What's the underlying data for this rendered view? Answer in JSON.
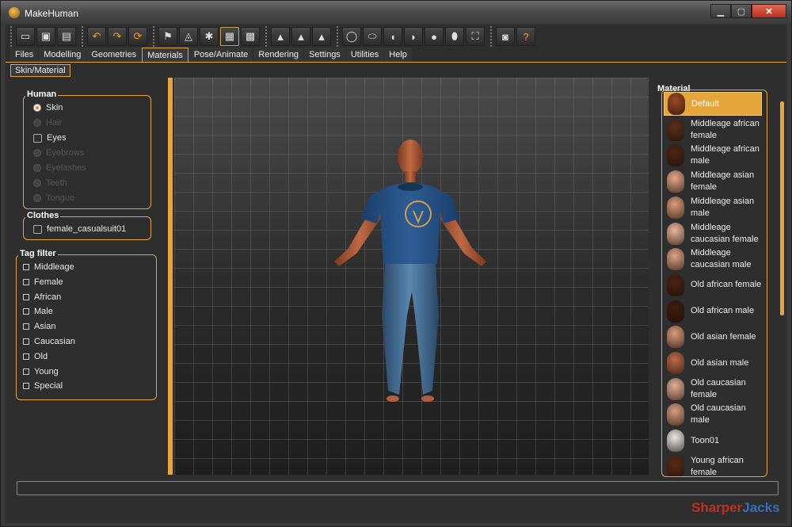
{
  "window": {
    "title": "MakeHuman",
    "min_symbol": "▁",
    "max_symbol": "▢",
    "close_symbol": "✕"
  },
  "toolbar": {
    "groups": [
      [
        {
          "icon": "load-icon",
          "glyph": "▭"
        },
        {
          "icon": "save-icon",
          "glyph": "▣"
        },
        {
          "icon": "export-icon",
          "glyph": "▤"
        }
      ],
      [
        {
          "icon": "undo-icon",
          "glyph": "↶"
        },
        {
          "icon": "redo-icon",
          "glyph": "↷"
        },
        {
          "icon": "reset-icon",
          "glyph": "⟳"
        }
      ],
      [
        {
          "icon": "smooth-icon",
          "glyph": "⚑"
        },
        {
          "icon": "wireframe-icon",
          "glyph": "◬"
        },
        {
          "icon": "pose-icon",
          "glyph": "✱"
        },
        {
          "icon": "grid-icon",
          "glyph": "▦"
        },
        {
          "icon": "checker-icon",
          "glyph": "▩"
        }
      ],
      [
        {
          "icon": "front-view-icon",
          "glyph": "▲"
        },
        {
          "icon": "back-view-icon",
          "glyph": "▲"
        },
        {
          "icon": "side-view-icon",
          "glyph": "▲"
        }
      ],
      [
        {
          "icon": "head-front-icon",
          "glyph": "◯"
        },
        {
          "icon": "head-back-icon",
          "glyph": "⬭"
        },
        {
          "icon": "head-left-icon",
          "glyph": "◖"
        },
        {
          "icon": "head-right-icon",
          "glyph": "◗"
        },
        {
          "icon": "head-top-icon",
          "glyph": "●"
        },
        {
          "icon": "head-bottom-icon",
          "glyph": "⬮"
        },
        {
          "icon": "reset-camera-icon",
          "glyph": "⛶"
        }
      ],
      [
        {
          "icon": "screenshot-icon",
          "glyph": "◙"
        },
        {
          "icon": "help-icon",
          "glyph": "?"
        }
      ]
    ]
  },
  "tabs": [
    "Files",
    "Modelling",
    "Geometries",
    "Materials",
    "Pose/Animate",
    "Rendering",
    "Settings",
    "Utilities",
    "Help"
  ],
  "active_tab": "Materials",
  "subtab": "Skin/Material",
  "human": {
    "title": "Human",
    "items": [
      {
        "label": "Skin",
        "selected": true,
        "enabled": true
      },
      {
        "label": "Hair",
        "selected": false,
        "enabled": false
      },
      {
        "label": "Eyes",
        "selected": false,
        "enabled": true
      },
      {
        "label": "Eyebrows",
        "selected": false,
        "enabled": false
      },
      {
        "label": "Eyelashes",
        "selected": false,
        "enabled": false
      },
      {
        "label": "Teeth",
        "selected": false,
        "enabled": false
      },
      {
        "label": "Tongue",
        "selected": false,
        "enabled": false
      }
    ]
  },
  "clothes": {
    "title": "Clothes",
    "items": [
      "female_casualsuit01"
    ]
  },
  "tag_filter": {
    "title": "Tag filter",
    "items": [
      "Middleage",
      "Female",
      "African",
      "Male",
      "Asian",
      "Caucasian",
      "Old",
      "Young",
      "Special"
    ]
  },
  "material": {
    "title": "Material",
    "items": [
      {
        "label": "Default",
        "tone": "#9a4a25",
        "selected": true
      },
      {
        "label": "Middleage african female",
        "tone": "#5a2f1c"
      },
      {
        "label": "Middleage african male",
        "tone": "#4c2716"
      },
      {
        "label": "Middleage asian female",
        "tone": "#e0a888"
      },
      {
        "label": "Middleage asian male",
        "tone": "#d89c7c"
      },
      {
        "label": "Middleage caucasian female",
        "tone": "#e8b49a"
      },
      {
        "label": "Middleage caucasian male",
        "tone": "#dca286"
      },
      {
        "label": "Old african female",
        "tone": "#4a2414"
      },
      {
        "label": "Old african male",
        "tone": "#3e1e10"
      },
      {
        "label": "Old asian female",
        "tone": "#d89a78"
      },
      {
        "label": "Old asian male",
        "tone": "#b86a48"
      },
      {
        "label": "Old caucasian female",
        "tone": "#e2ae96"
      },
      {
        "label": "Old caucasian male",
        "tone": "#d69c80"
      },
      {
        "label": "Toon01",
        "tone": "#e8e8e8"
      },
      {
        "label": "Young african female",
        "tone": "#5a2c18"
      }
    ]
  },
  "watermark": {
    "part1": "Sharper",
    "part2": "Jacks",
    "color1": "#c03020",
    "color2": "#3070c0"
  },
  "colors": {
    "accent": "#e5a53a"
  }
}
